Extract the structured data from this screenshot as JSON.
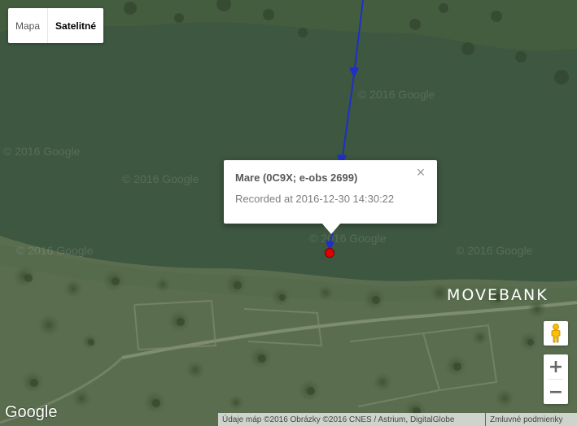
{
  "map_type": {
    "map_label": "Mapa",
    "satellite_label": "Satelitné",
    "selected": "satellite"
  },
  "watermarks": [
    "© 2016 Google",
    "© 2016 Google",
    "© 2016 Google",
    "© 2016 Google",
    "© 2016 Google",
    "© 2016 Google"
  ],
  "info_window": {
    "title": "Mare (0C9X; e-obs 2699)",
    "subtitle": "Recorded at 2016-12-30 14:30:22",
    "close_symbol": "×"
  },
  "track": {
    "line_color": "#1f2fc8",
    "marker_color": "#e00000"
  },
  "brand": {
    "movebank": "MOVEBANK",
    "google": "Google"
  },
  "zoom": {
    "in": "+",
    "out": "−"
  },
  "attribution": {
    "data": "Údaje máp ©2016 Obrázky ©2016 CNES / Astrium, DigitalGlobe",
    "terms": "Zmluvné podmienky"
  },
  "colors": {
    "water": "#3b5540",
    "land": "#5b6f50"
  }
}
